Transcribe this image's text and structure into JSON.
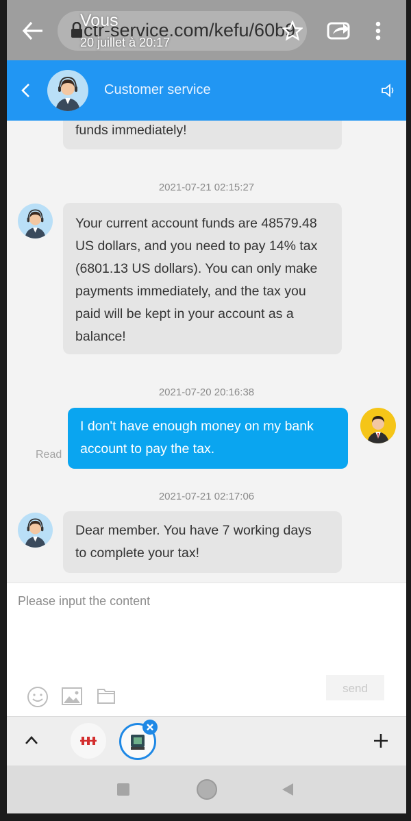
{
  "browser": {
    "url": "ctr-service.com/kefu/60b9",
    "notification_name": "Vous",
    "notification_date": "20 juillet à 20:17"
  },
  "header": {
    "title": "Customer service"
  },
  "messages": [
    {
      "sender": "agent",
      "text": "funds immediately!"
    },
    {
      "timestamp": "2021-07-21 02:15:27",
      "sender": "agent",
      "lines": [
        "Your current account funds are 48579.48",
        "US dollars, and you need to pay 14% tax",
        "(6801.13 US dollars). You can only make",
        "payments immediately, and the tax you",
        "paid will be kept in your account as a",
        "balance!"
      ]
    },
    {
      "timestamp": "2021-07-20 20:16:38",
      "sender": "user",
      "status": "Read",
      "lines": [
        "I don't have enough money on my bank",
        "account to pay the tax."
      ]
    },
    {
      "timestamp": "2021-07-21 02:17:06",
      "sender": "agent",
      "lines": [
        "Dear member. You have 7 working days",
        "to complete your tax!"
      ]
    }
  ],
  "input": {
    "placeholder": "Please input the content",
    "send_label": "send"
  },
  "icons": [
    "back-arrow-icon",
    "lock-icon",
    "star-icon",
    "share-icon",
    "more-vert-icon",
    "chevron-left-icon",
    "speaker-icon",
    "emoji-icon",
    "image-icon",
    "folder-icon",
    "chevron-up-icon",
    "plus-icon",
    "close-icon"
  ],
  "colors": {
    "header": "#2196f3",
    "user_bubble": "#0aa5f0",
    "agent_bubble": "#e5e5e5"
  }
}
